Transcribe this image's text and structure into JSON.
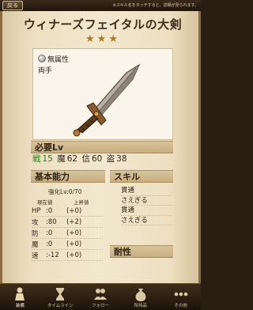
{
  "topbar": {
    "back_label": "戻る",
    "hint": "※スキル名をタッチすると、詳細が見られます。"
  },
  "weapon": {
    "name": "ウィナーズフェイタルの大剣",
    "stars": "★★★",
    "attribute": "無属性",
    "hand": "両手"
  },
  "requirements": {
    "header": "必要Lv",
    "war_label": "戦",
    "war_value": "15",
    "magic_label": "魔",
    "magic_value": "62",
    "faith_label": "信",
    "faith_value": "60",
    "thief_label": "盗",
    "thief_value": "38"
  },
  "basic": {
    "header": "基本能力",
    "enhance": "強化Lv:0/70",
    "col_current": "現在値",
    "col_limit": "上昇値",
    "stats": [
      {
        "name": "HP",
        "value": ":0",
        "plus": "(+0)"
      },
      {
        "name": "攻",
        "value": ":80",
        "plus": "(+2)"
      },
      {
        "name": "防",
        "value": ":0",
        "plus": "(+0)"
      },
      {
        "name": "魔",
        "value": ":0",
        "plus": "(+0)"
      },
      {
        "name": "速",
        "value": ":-12",
        "plus": "(+0)"
      }
    ]
  },
  "skills": {
    "header": "スキル",
    "items": [
      "貫通",
      "さえぎる",
      "貫通",
      "さえぎる"
    ]
  },
  "resistance": {
    "header": "耐性"
  },
  "nav": {
    "items": [
      {
        "label": "装備",
        "icon": "character-icon"
      },
      {
        "label": "タイムライン",
        "icon": "hourglass-icon"
      },
      {
        "label": "フォロー",
        "icon": "people-icon"
      },
      {
        "label": "所持品",
        "icon": "bag-icon"
      },
      {
        "label": "その他",
        "icon": "more-icon"
      }
    ]
  },
  "colors": {
    "war_green": "#2f7a1d",
    "star_gold": "#b07a1e",
    "parchment": "#f2e8cf"
  }
}
